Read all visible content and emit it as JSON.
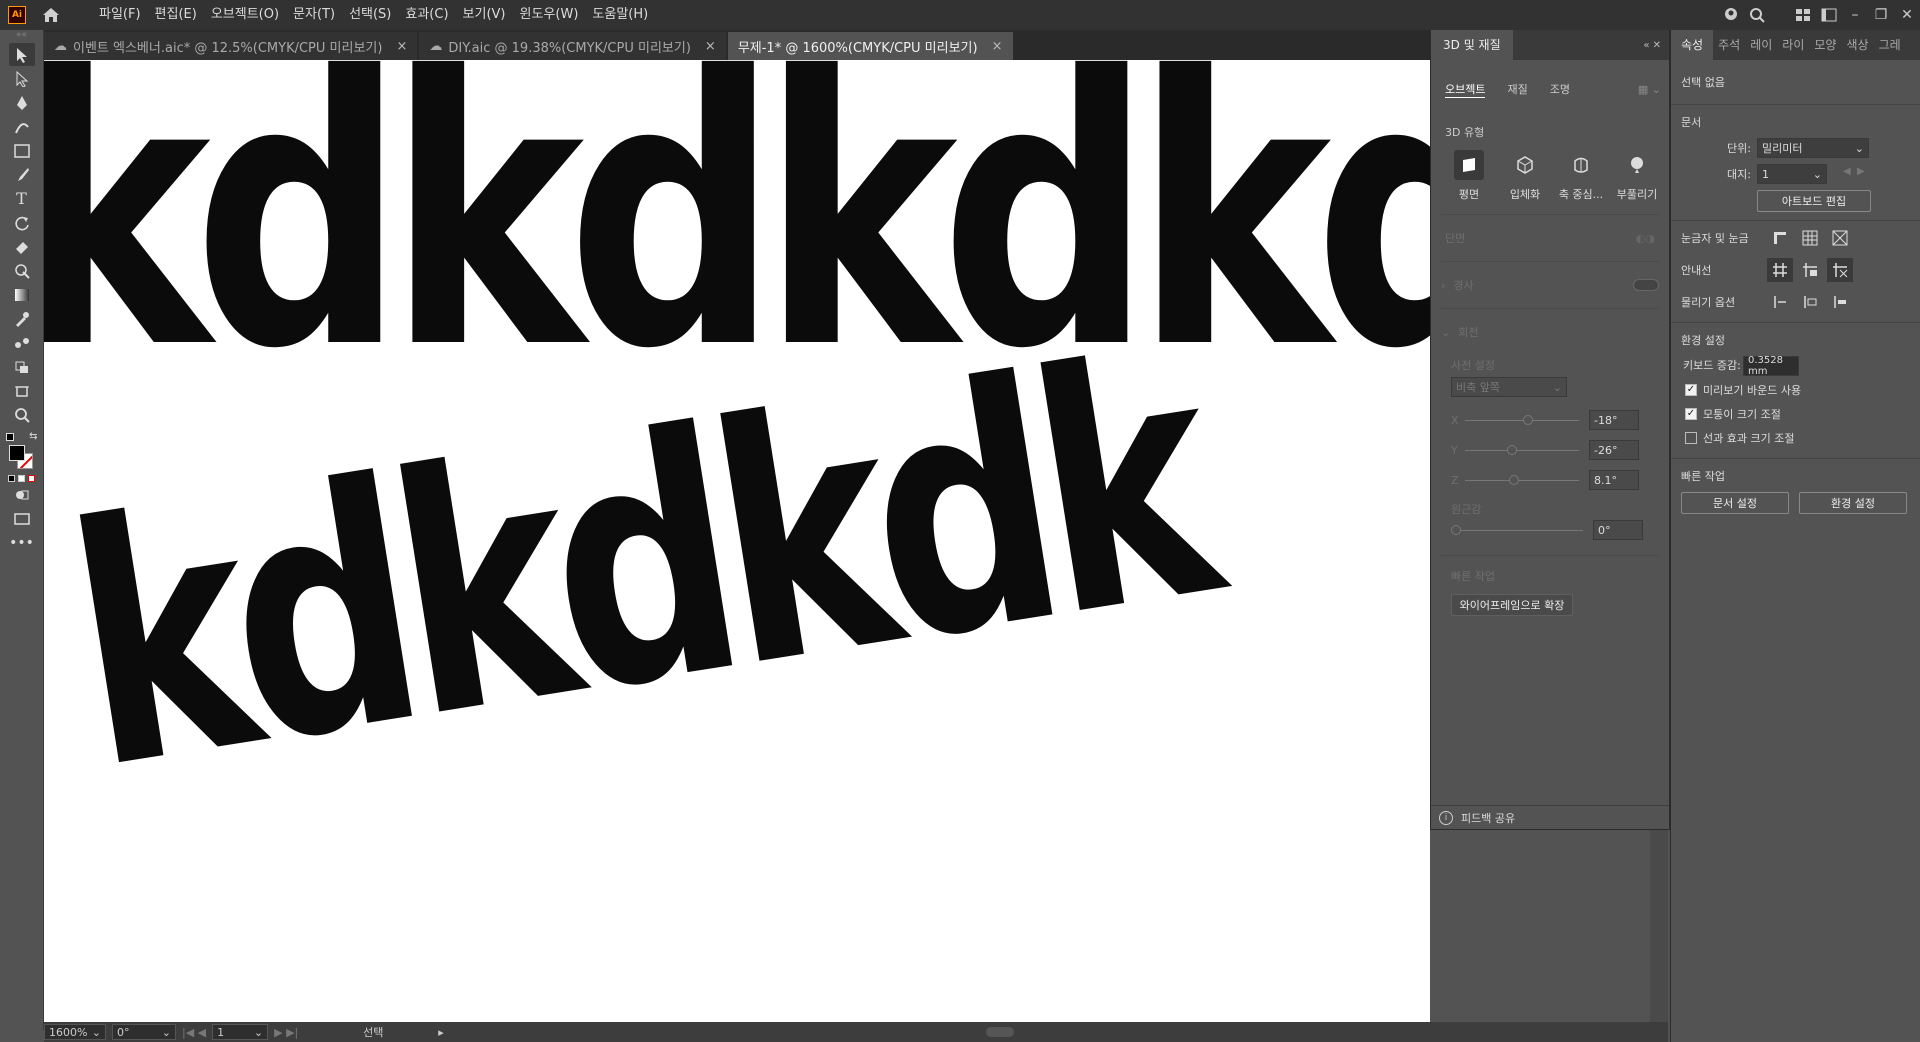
{
  "app": {
    "logo_text": "Ai"
  },
  "menu": [
    "파일(F)",
    "편집(E)",
    "오브젝트(O)",
    "문자(T)",
    "선택(S)",
    "효과(C)",
    "보기(V)",
    "윈도우(W)",
    "도움말(H)"
  ],
  "tabs": [
    {
      "label": "이벤트 엑스베너.aic* @ 12.5%(CMYK/CPU 미리보기)",
      "cloud": true,
      "active": false
    },
    {
      "label": "DIY.aic @ 19.38%(CMYK/CPU 미리보기)",
      "cloud": true,
      "active": false
    },
    {
      "label": "무제-1* @ 1600%(CMYK/CPU 미리보기)",
      "cloud": false,
      "active": true
    }
  ],
  "canvas_text": {
    "line1": "kdkdkdkdk",
    "line2": "kdkdkdk"
  },
  "status": {
    "zoom": "1600%",
    "angle": "0°",
    "artboard": "1",
    "tool": "선택"
  },
  "panel3d": {
    "title": "3D 및 재질",
    "subtabs": [
      "오브젝트",
      "재질",
      "조명"
    ],
    "type_label": "3D 유형",
    "types": [
      "평면",
      "입체화",
      "축 중심...",
      "부풀리기"
    ],
    "cap_label": "단면",
    "bevel_label": "경사",
    "rotation_label": "회전",
    "preset_label": "사전 설정",
    "preset_value": "비축 앞쪽",
    "x_label": "X",
    "x_value": "-18°",
    "y_label": "Y",
    "y_value": "-26°",
    "z_label": "Z",
    "z_value": "8.1°",
    "perspective_label": "원근감",
    "perspective_value": "0°",
    "quick_label": "빠른 작업",
    "quick_button": "와이어프레임으로 확장",
    "feedback": "피드백 공유"
  },
  "props": {
    "tabs": [
      "속성",
      "주석",
      "레이",
      "라이",
      "모양",
      "색상",
      "그레"
    ],
    "selection": "선택 없음",
    "document_label": "문서",
    "unit_label": "단위:",
    "unit_value": "밀리미터",
    "artboard_label": "대지:",
    "artboard_value": "1",
    "edit_artboard": "아트보드 편집",
    "rulers_label": "눈금자 및 눈금",
    "guides_label": "안내선",
    "snap_label": "물리기 옵션",
    "prefs_label": "환경 설정",
    "keyboard_label": "키보드 증감:",
    "keyboard_value": "0.3528 mm",
    "cb1": "미리보기 바운드 사용",
    "cb2": "모퉁이 크기 조절",
    "cb3": "선과 효과 크기 조절",
    "quick_label": "빠른 작업",
    "doc_setup": "문서 설정",
    "prefs_button": "환경 설정"
  }
}
